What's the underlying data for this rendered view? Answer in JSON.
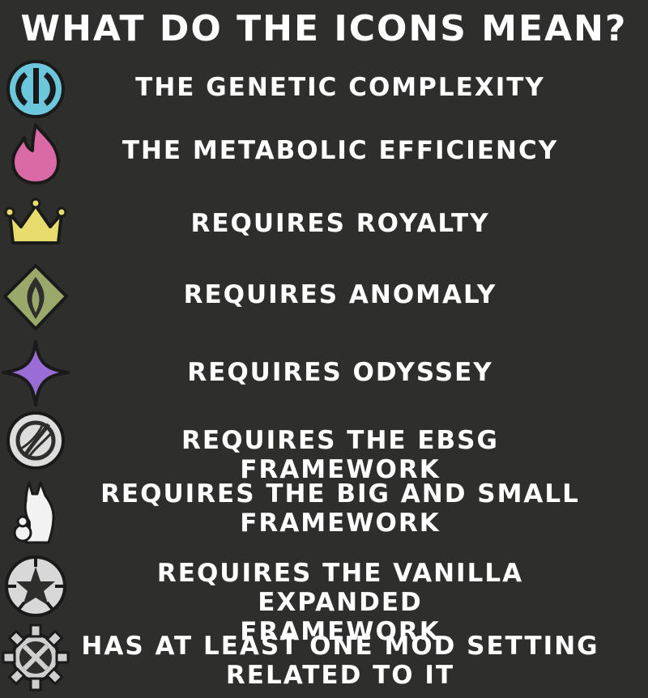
{
  "title": "WHAT DO THE ICONS MEAN?",
  "legend": [
    {
      "icon": "genetic-complexity-icon",
      "color": "#6cc6dc",
      "label": "THE GENETIC COMPLEXITY"
    },
    {
      "icon": "metabolic-efficiency-icon",
      "color": "#d96aa5",
      "label": "THE METABOLIC EFFICIENCY"
    },
    {
      "icon": "royalty-crown-icon",
      "color": "#e8dc6c",
      "label": "REQUIRES ROYALTY"
    },
    {
      "icon": "anomaly-icon",
      "color": "#9aa86a",
      "label": "REQUIRES ANOMALY"
    },
    {
      "icon": "odyssey-icon",
      "color": "#9a6cd6",
      "label": "REQUIRES ODYSSEY"
    },
    {
      "icon": "ebsg-framework-icon",
      "color": "#dddddd",
      "label": "REQUIRES THE EBSG FRAMEWORK"
    },
    {
      "icon": "big-and-small-framework-icon",
      "color": "#f2f2f2",
      "label": [
        "REQUIRES THE BIG AND SMALL",
        "FRAMEWORK"
      ]
    },
    {
      "icon": "vanilla-expanded-framework-icon",
      "color": "#d8d8d8",
      "label": [
        "REQUIRES THE VANILLA EXPANDED",
        "FRAMEWORK"
      ]
    },
    {
      "icon": "mod-setting-gear-icon",
      "color": "#cfcfcf",
      "label": [
        "HAS AT LEAST ONE MOD SETTING",
        "RELATED TO IT"
      ]
    }
  ]
}
